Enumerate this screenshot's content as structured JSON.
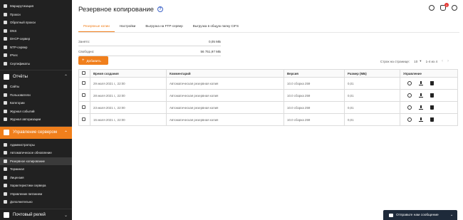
{
  "sidebar": {
    "group1": [
      "Маршрутизация",
      "Прокси",
      "Обратный прокси",
      "DNS",
      "DHCP-сервер",
      "NTP-сервер",
      "IPsec",
      "Сертификаты"
    ],
    "reports": {
      "label": "Отчёты",
      "items": [
        "Сайты",
        "Пользователи",
        "Категории",
        "Журнал событий",
        "Журнал авторизации"
      ]
    },
    "server": {
      "label": "Управление сервером",
      "items": [
        "Администраторы",
        "Автоматическое обновление",
        "Резервное копирование",
        "Терминал",
        "Лицензия",
        "Характеристики сервера",
        "Управление питанием",
        "Дополнительно"
      ]
    },
    "mail": {
      "label": "Почтовый релей"
    }
  },
  "header": {
    "title": "Резервное копирование",
    "notification_count": "1"
  },
  "tabs": [
    "Резервные копии",
    "Настройки",
    "Выгрузка на FTP-сервер",
    "Выгрузка в общую папку CIFS"
  ],
  "info": {
    "used_label": "Занято:",
    "used_value": "0,05 МБ",
    "free_label": "Свободно:",
    "free_value": "56 751,97 МБ"
  },
  "add_button": "Добавить",
  "pager": {
    "rows_label": "Строк на странице:",
    "rows_value": "10",
    "range": "1-4 из 4"
  },
  "table": {
    "headers": [
      "Время создания",
      "Комментарий",
      "Версия",
      "Размер (МБ)",
      "Управление"
    ],
    "rows": [
      [
        "29 июля 2021 г., 22:00",
        "Автоматическая резервная копия",
        "10.0 сборка 259",
        "0,01"
      ],
      [
        "28 июля 2021 г., 22:00",
        "Автоматическая резервная копия",
        "10.0 сборка 259",
        "0,01"
      ],
      [
        "23 июля 2021 г., 22:00",
        "Автоматическая резервная копия",
        "10.0 сборка 259",
        "0,01"
      ],
      [
        "15 июля 2021 г., 22:00",
        "Автоматическая резервная копия",
        "10.0 сборка 259",
        "0,01"
      ]
    ]
  },
  "chat": {
    "label": "Отправьте нам сообщение"
  }
}
